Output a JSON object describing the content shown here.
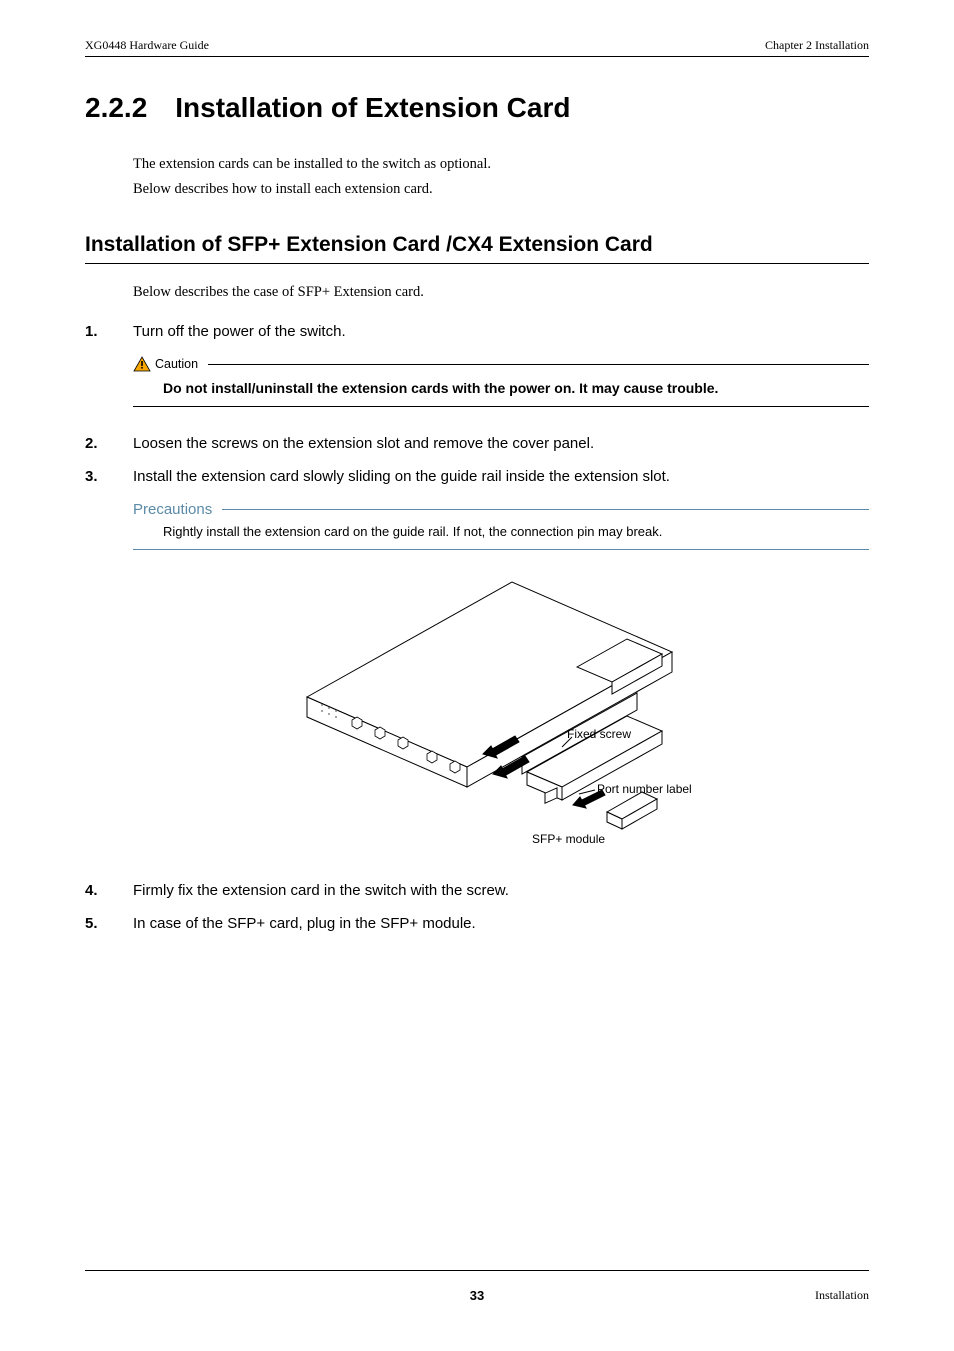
{
  "header": {
    "left": "XG0448 Hardware Guide",
    "right": "Chapter 2 Installation"
  },
  "section": {
    "number": "2.2.2",
    "title": "Installation of Extension Card",
    "intro_line1": "The extension cards can be installed to the switch as optional.",
    "intro_line2": "Below describes how to install each extension card."
  },
  "subsection": {
    "title": "Installation of SFP+ Extension Card /CX4 Extension Card",
    "intro": "Below describes the case of SFP+ Extension card."
  },
  "steps": {
    "s1": {
      "num": "1.",
      "text": "Turn off the power of the switch."
    },
    "s2": {
      "num": "2.",
      "text": "Loosen the screws on the extension slot and remove the cover panel."
    },
    "s3": {
      "num": "3.",
      "text": "Install the extension card slowly sliding on the guide rail inside the extension slot."
    },
    "s4": {
      "num": "4.",
      "text": "Firmly fix the extension card in the switch with the screw."
    },
    "s5": {
      "num": "5.",
      "text": "In case of the SFP+ card, plug in the SFP+ module."
    }
  },
  "caution": {
    "label": "Caution",
    "body": "Do not install/uninstall the extension cards with the power on. It may cause trouble."
  },
  "precautions": {
    "label": "Precautions",
    "body": "Rightly install the extension card on the guide rail. If not, the connection pin may break."
  },
  "figure_labels": {
    "fixed_screw": "Fixed screw",
    "port_number": "Port number label",
    "sfp_module": "SFP+ module"
  },
  "footer": {
    "page_number": "33",
    "right": "Installation"
  }
}
